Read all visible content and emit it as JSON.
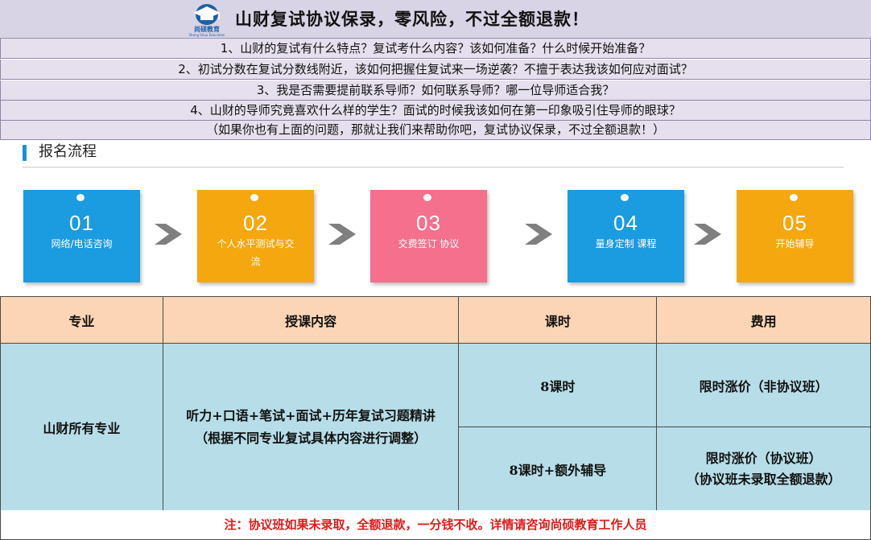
{
  "banner": {
    "logo_text": "尚硕教育",
    "logo_sub": "Shang Shuo Education",
    "title": "山财复试协议保录，零风险，不过全额退款！"
  },
  "questions": [
    "1、山财的复试有什么特点？复试考什么内容？该如何准备？什么时候开始准备？",
    "2、初试分数在复试分数线附近，该如何把握住复试来一场逆袭？不擅于表达我该如何应对面试？",
    "3、我是否需要提前联系导师？如何联系导师？哪一位导师适合我？",
    "4、山财的导师究竟喜欢什么样的学生？面试的时候我该如何在第一印象吸引住导师的眼球？",
    "（如果你也有上面的问题，那就让我们来帮助你吧，复试协议保录，不过全额退款！）"
  ],
  "process": {
    "title": "报名流程",
    "steps": [
      {
        "num": "01",
        "label": "网络/电话咨询",
        "color": "#1b9be0"
      },
      {
        "num": "02",
        "label": "个人水平测试与交流",
        "color": "#f5a70f"
      },
      {
        "num": "03",
        "label": "交费签订 协议",
        "color": "#f4708c"
      },
      {
        "num": "04",
        "label": "量身定制 课程",
        "color": "#1b9be0"
      },
      {
        "num": "05",
        "label": "开始辅导",
        "color": "#f5a70f"
      }
    ],
    "arrow_color": "#7f7f7f"
  },
  "table": {
    "headers": [
      "专业",
      "授课内容",
      "课时",
      "费用"
    ],
    "major": "山财所有专业",
    "content_line1": "听力+口语+笔试+面试+历年复试习题精讲",
    "content_line2": "（根据不同专业复试具体内容进行调整）",
    "hours_1": "8课时",
    "hours_2": "8课时+额外辅导",
    "fee_1": "限时涨价（非协议班）",
    "fee_2_line1": "限时涨价（协议班）",
    "fee_2_line2": "（协议班未录取全额退款）"
  },
  "footnote": "注：协议班如果未录取，全额退款，一分钱不收。详情请咨询尚硕教育工作人员"
}
